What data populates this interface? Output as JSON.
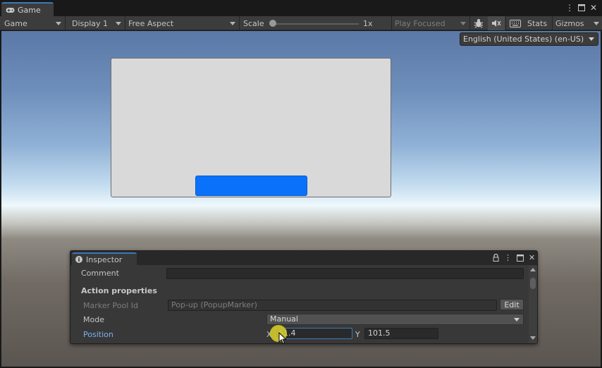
{
  "tab": {
    "title": "Game",
    "icon": "gamepad-icon"
  },
  "window_controls": [
    "more-icon",
    "maximize-icon",
    "close-icon"
  ],
  "toolbar": {
    "game_mode": "Game",
    "display": "Display 1",
    "aspect": "Free Aspect",
    "scale_label": "Scale",
    "scale_value": "1x",
    "scale_level": 0.0,
    "play_mode": "Play Focused",
    "stats_label": "Stats",
    "gizmos_label": "Gizmos"
  },
  "game": {
    "language": "English (United States) (en-US)",
    "popup_background": "#d9d9d9",
    "popup_button_color": "#0a72fa"
  },
  "inspector": {
    "title": "Inspector",
    "comment_label": "Comment",
    "comment_value": "",
    "section_title": "Action properties",
    "marker_pool_label": "Marker Pool Id",
    "marker_pool_value": "Pop-up (PopupMarker)",
    "edit_label": "Edit",
    "mode_label": "Mode",
    "mode_value": "Manual",
    "position_label": "Position",
    "x_label": "X",
    "x_value": "61.4",
    "y_label": "Y",
    "y_value": "101.5"
  },
  "colors": {
    "accent": "#3a79bb",
    "position_label": "#7bb2f0"
  }
}
